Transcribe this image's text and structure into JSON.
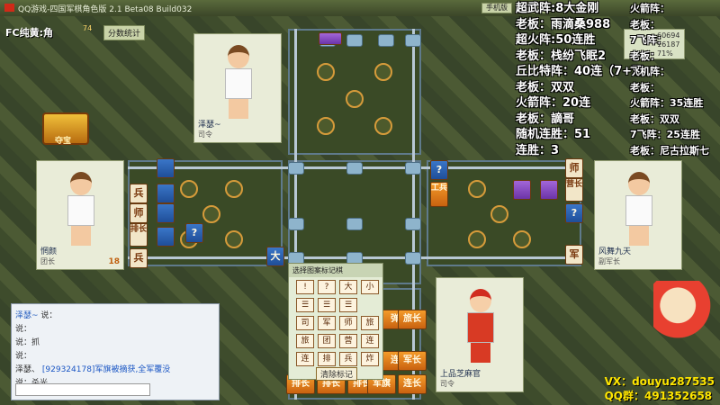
{
  "window": {
    "title": "QQ游戏-四国军棋角色版 2.1 Beta08 Build032",
    "btn_minimize": "手机版",
    "btn_options": "选项"
  },
  "top_left": {
    "user_label": "FC纯黄:角",
    "level": "74",
    "score_button": "分数统计"
  },
  "treasure_label": "夺宝",
  "players": {
    "top": {
      "name": "泽瑟~",
      "rank": "司令"
    },
    "left": {
      "name": "惘颜",
      "rank": "团长",
      "score": "18"
    },
    "right": {
      "name": "风舞九天",
      "rank": "副军长"
    },
    "bottom": {
      "name": "上品芝麻官",
      "rank": "司令"
    }
  },
  "right_stats": {
    "l1": "60694",
    "l2": "16187",
    "l3": "71%"
  },
  "overlay_left": [
    "超武阵:8大金刚",
    "老板：雨滴桑988",
    "超火阵:50连胜",
    "老板：栈纷飞眠2",
    "丘比特阵：40连（7+双",
    "老板：双双",
    "火箭阵：20连",
    "老板：謫哥",
    "随机连胜：51",
    "连胜：3"
  ],
  "overlay_right": [
    "火箭阵：",
    "老板：",
    "7飞阵：",
    "老板：",
    "飞机阵：",
    "老板：",
    "火箭阵：35连胜",
    "老板：双双",
    "7飞阵：25连胜",
    "老板：尼古拉斯七"
  ],
  "marker_panel": {
    "title": "选择图案标记棋",
    "row1": [
      "!",
      "?",
      "大",
      "小"
    ],
    "row2": [
      "司",
      "军",
      "师",
      "旅"
    ],
    "row3": [
      "旅",
      "团",
      "营",
      "连"
    ],
    "row4": [
      "连",
      "排",
      "兵",
      "炸"
    ],
    "clear_button": "清除标记"
  },
  "board_pieces": {
    "left_col": [
      "兵",
      "师",
      "排长",
      "兵"
    ],
    "right_col": [
      "师",
      "营长",
      "?",
      "军"
    ],
    "center_top_piece": "?",
    "center_left_piece": "工兵",
    "center_dai": "大",
    "bottom_row": [
      "排长",
      "排长",
      "排长",
      "军旗",
      "连长"
    ],
    "bottom_right_stack": [
      "弹",
      "旅长",
      "连",
      "军长"
    ]
  },
  "chat": {
    "lines": [
      {
        "name": "泽瑟~",
        "says": "说："
      },
      {
        "name": "",
        "says": "说："
      },
      {
        "name": "",
        "says": "说：抓"
      },
      {
        "name": "",
        "says": "说："
      },
      {
        "name": "",
        "says": "说：杀光"
      }
    ],
    "system": "[929324178]军旗被摘获,全军覆没",
    "system_user": "泽瑟、"
  },
  "footer": {
    "vx": "VX：douyu",
    "vx_id": "287535",
    "qq": "QQ群：491352658"
  }
}
